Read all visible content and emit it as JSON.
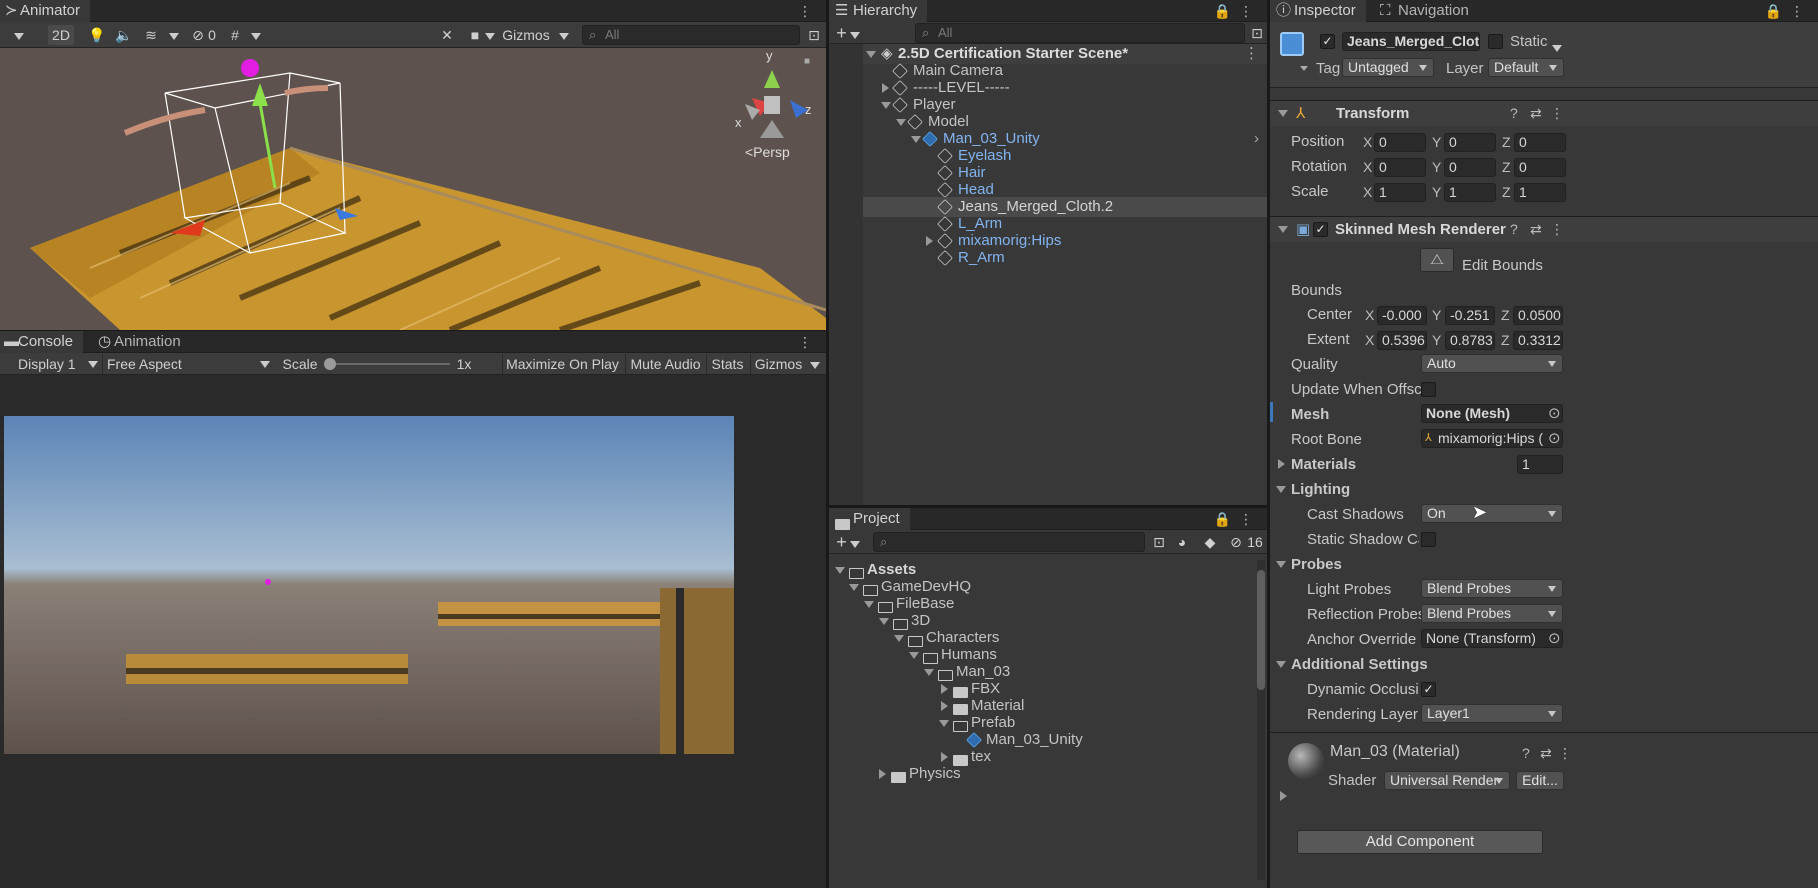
{
  "animator": {
    "tab": "Animator",
    "toolbar": {
      "mode_2d": "2D",
      "hidden_count": "0",
      "gizmos": "Gizmos",
      "search_placeholder": "All"
    },
    "gizmo": {
      "x": "x",
      "y": "y",
      "z": "z",
      "persp": "<Persp"
    }
  },
  "game": {
    "tab_console": "Console",
    "tab_animation": "Animation",
    "display": "Display 1",
    "aspect": "Free Aspect",
    "scale_label": "Scale",
    "scale_value": "1x",
    "maximize": "Maximize On Play",
    "mute": "Mute Audio",
    "stats": "Stats",
    "gizmos": "Gizmos"
  },
  "hierarchy": {
    "tab": "Hierarchy",
    "search_placeholder": "All",
    "scene": "2.5D Certification Starter Scene*",
    "items": [
      {
        "label": "Main Camera"
      },
      {
        "label": "-----LEVEL-----"
      },
      {
        "label": "Player"
      },
      {
        "label": "Model"
      },
      {
        "label": "Man_03_Unity"
      },
      {
        "label": "Eyelash"
      },
      {
        "label": "Hair"
      },
      {
        "label": "Head"
      },
      {
        "label": "Jeans_Merged_Cloth.2"
      },
      {
        "label": "L_Arm"
      },
      {
        "label": "mixamorig:Hips"
      },
      {
        "label": "R_Arm"
      }
    ]
  },
  "project": {
    "tab": "Project",
    "hidden_count": "16",
    "items": [
      {
        "label": "Assets"
      },
      {
        "label": "GameDevHQ"
      },
      {
        "label": "FileBase"
      },
      {
        "label": "3D"
      },
      {
        "label": "Characters"
      },
      {
        "label": "Humans"
      },
      {
        "label": "Man_03"
      },
      {
        "label": "FBX"
      },
      {
        "label": "Material"
      },
      {
        "label": "Prefab"
      },
      {
        "label": "Man_03_Unity"
      },
      {
        "label": "tex"
      },
      {
        "label": "Physics"
      }
    ]
  },
  "inspector": {
    "tab": "Inspector",
    "tab2": "Navigation",
    "object_name": "Jeans_Merged_Cloth",
    "static_label": "Static",
    "tag_label": "Tag",
    "tag_value": "Untagged",
    "layer_label": "Layer",
    "layer_value": "Default",
    "transform": {
      "title": "Transform",
      "position": {
        "label": "Position",
        "x": "0",
        "y": "0",
        "z": "0"
      },
      "rotation": {
        "label": "Rotation",
        "x": "0",
        "y": "0",
        "z": "0"
      },
      "scale": {
        "label": "Scale",
        "x": "1",
        "y": "1",
        "z": "1"
      }
    },
    "smr": {
      "title": "Skinned Mesh Renderer",
      "edit_bounds": "Edit Bounds",
      "bounds": "Bounds",
      "center": {
        "label": "Center",
        "x": "-0.000",
        "y": "-0.251",
        "z": "0.0500"
      },
      "extent": {
        "label": "Extent",
        "x": "0.5396",
        "y": "0.8783",
        "z": "0.3312"
      },
      "quality_label": "Quality",
      "quality_value": "Auto",
      "update_label": "Update When Offscre",
      "mesh_label": "Mesh",
      "mesh_value": "None (Mesh)",
      "rootbone_label": "Root Bone",
      "rootbone_value": "mixamorig:Hips (",
      "materials_label": "Materials",
      "materials_count": "1",
      "lighting": "Lighting",
      "cast_label": "Cast Shadows",
      "cast_value": "On",
      "static_shadow_label": "Static Shadow Ca",
      "probes": "Probes",
      "light_probes_label": "Light Probes",
      "light_probes_value": "Blend Probes",
      "refl_label": "Reflection Probes",
      "refl_value": "Blend Probes",
      "anchor_label": "Anchor Override",
      "anchor_value": "None (Transform)",
      "additional": "Additional Settings",
      "dyn_label": "Dynamic Occlusic",
      "rlayer_label": "Rendering Layer M",
      "rlayer_value": "Layer1"
    },
    "material": {
      "name": "Man_03 (Material)",
      "shader_label": "Shader",
      "shader_value": "Universal Render",
      "edit": "Edit..."
    },
    "add_component": "Add Component"
  },
  "colors": {
    "accent": "#3a79bb",
    "prefab": "#82b4f0",
    "sky_top": "#5d85b5",
    "ground": "#6a5d57"
  }
}
